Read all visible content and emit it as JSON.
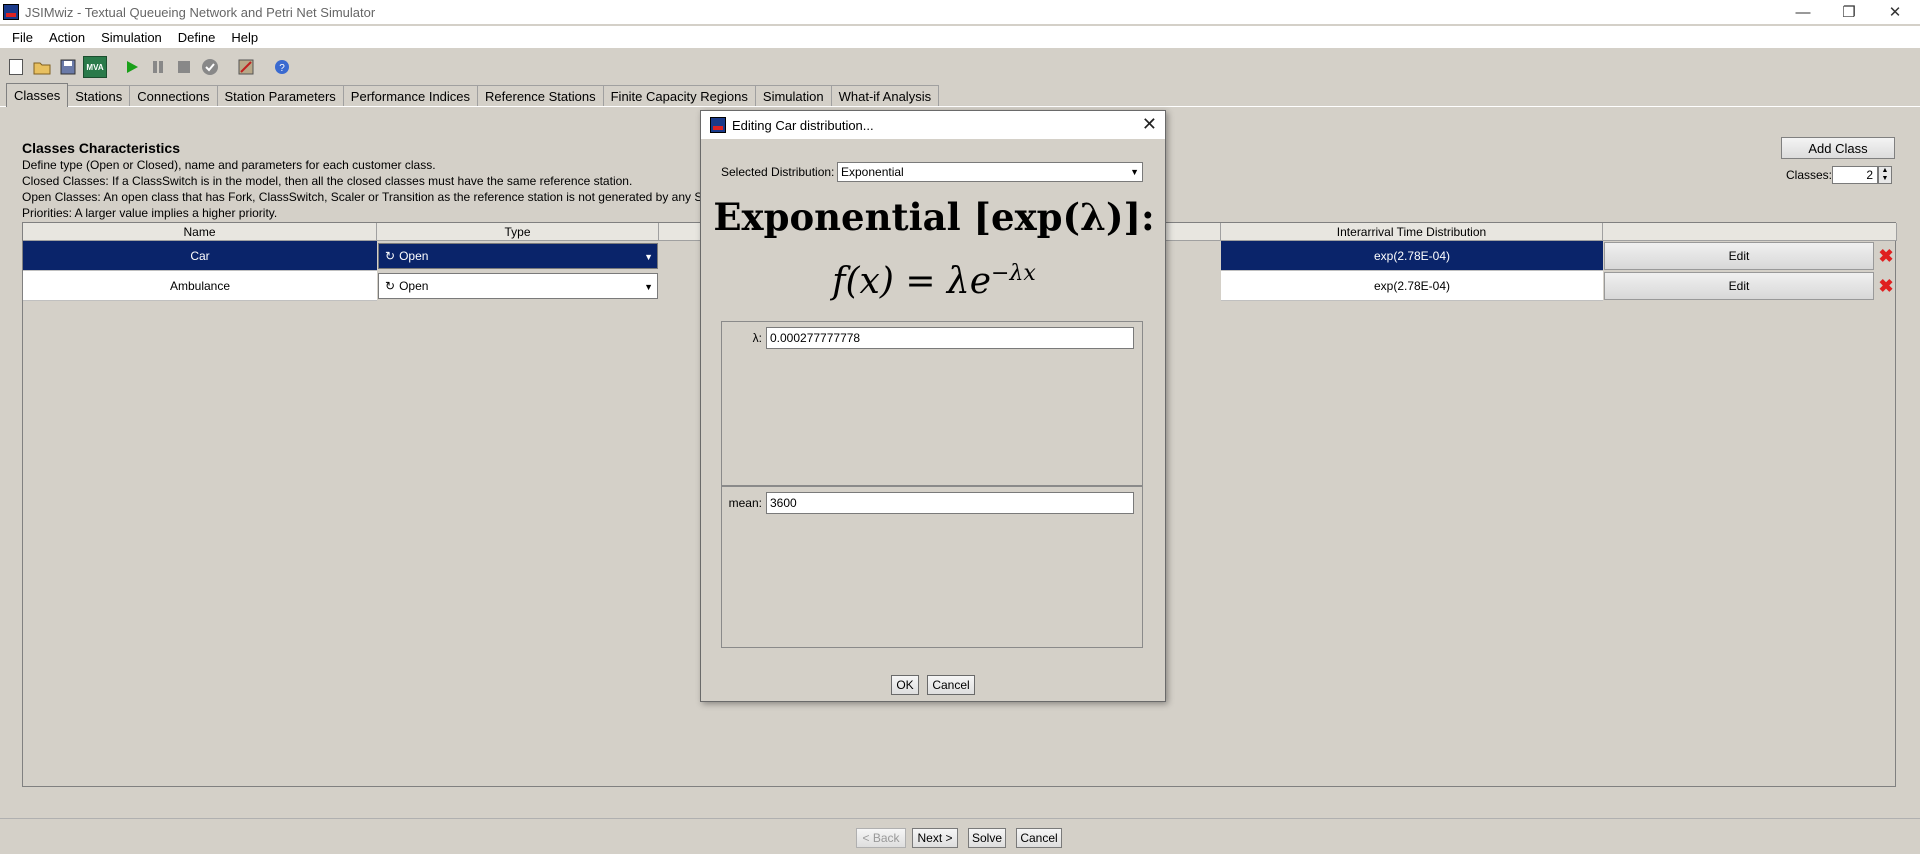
{
  "window": {
    "title": "JSIMwiz - Textual Queueing Network and Petri Net Simulator",
    "controls": {
      "minimize": "—",
      "restore": "❐",
      "close": "✕"
    }
  },
  "menubar": {
    "items": [
      "File",
      "Action",
      "Simulation",
      "Define",
      "Help"
    ]
  },
  "toolbar": {
    "icons": [
      "new-file-icon",
      "open-folder-icon",
      "save-icon",
      "mva-icon",
      "play-icon",
      "pause-icon",
      "stop-icon",
      "check-icon",
      "tools-icon",
      "help-icon"
    ],
    "mva_label": "MVA"
  },
  "tabs": [
    "Classes",
    "Stations",
    "Connections",
    "Station Parameters",
    "Performance Indices",
    "Reference Stations",
    "Finite Capacity Regions",
    "Simulation",
    "What-if Analysis"
  ],
  "classes_panel": {
    "title": "Classes Characteristics",
    "descriptions": [
      "Define type (Open or Closed), name and parameters for each customer class.",
      "Closed Classes: If a ClassSwitch is in the model, then all the closed classes must have the same reference station.",
      "Open Classes: An open class that has Fork, ClassSwitch, Scaler or Transition as the reference station is not generated by any Sou",
      "Priorities: A larger value implies a higher priority."
    ],
    "add_class_label": "Add Class",
    "classes_count_label": "Classes:",
    "classes_count": "2"
  },
  "table": {
    "columns": [
      "Name",
      "Type",
      "",
      "Interarrival Time Distribution",
      ""
    ],
    "rows": [
      {
        "name": "Car",
        "type": "Open",
        "distribution": "exp(2.78E-04)",
        "edit": "Edit",
        "selected": true
      },
      {
        "name": "Ambulance",
        "type": "Open",
        "distribution": "exp(2.78E-04)",
        "edit": "Edit",
        "selected": false
      }
    ],
    "delete_icon": "✖"
  },
  "dialog": {
    "title": "Editing Car distribution...",
    "selected_distribution_label": "Selected Distribution:",
    "selected_distribution": "Exponential",
    "formula_title": "Exponential [exp(λ)]:",
    "formula_main": "f(x) = λe",
    "formula_exp": "−λx",
    "lambda_label": "λ:",
    "lambda_value": "0.000277777778",
    "mean_label": "mean:",
    "mean_value": "3600",
    "ok_label": "OK",
    "cancel_label": "Cancel"
  },
  "bottom": {
    "back": "< Back",
    "next": "Next >",
    "solve": "Solve",
    "cancel": "Cancel"
  },
  "colors": {
    "selection": "#0a246a",
    "delete": "#e02020",
    "background": "#d4d0c8"
  }
}
